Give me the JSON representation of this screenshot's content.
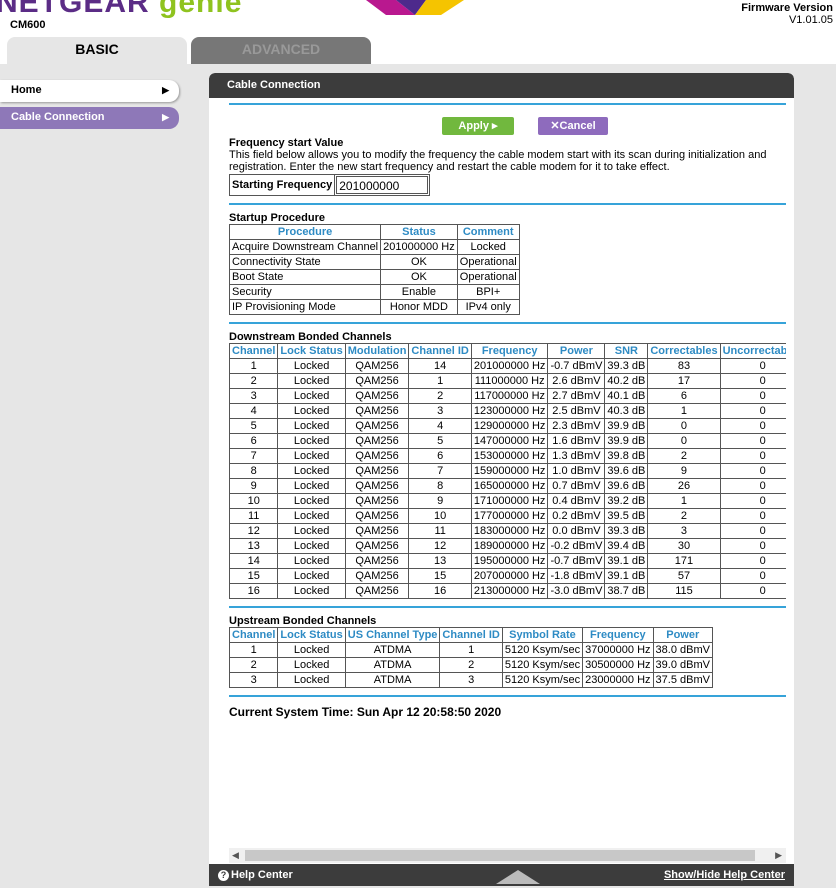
{
  "header": {
    "brand_main": "NETGEAR",
    "brand_genie": "genie",
    "model": "CM600",
    "firmware_label": "Firmware Version",
    "firmware_value": "V1.01.05"
  },
  "tabs": [
    {
      "label": "BASIC"
    },
    {
      "label": "ADVANCED"
    }
  ],
  "sidebar": {
    "items": [
      {
        "label": "Home"
      },
      {
        "label": "Cable Connection"
      }
    ]
  },
  "panel": {
    "title": "Cable Connection",
    "apply_label": "Apply ▸",
    "cancel_label": "✕Cancel",
    "freq": {
      "title": "Frequency start Value",
      "desc": "This field below allows you to modify the frequency the cable modem start with its scan during initialization and registration. Enter the new start frequency and restart the cable modem for it to take effect.",
      "label": "Starting Frequency",
      "value": "201000000"
    },
    "startup": {
      "title": "Startup Procedure",
      "headers": [
        "Procedure",
        "Status",
        "Comment"
      ],
      "rows": [
        [
          "Acquire Downstream Channel",
          "201000000 Hz",
          "Locked"
        ],
        [
          "Connectivity State",
          "OK",
          "Operational"
        ],
        [
          "Boot State",
          "OK",
          "Operational"
        ],
        [
          "Security",
          "Enable",
          "BPI+"
        ],
        [
          "IP Provisioning Mode",
          "Honor MDD",
          "IPv4 only"
        ]
      ]
    },
    "downstream": {
      "title": "Downstream Bonded Channels",
      "headers": [
        "Channel",
        "Lock Status",
        "Modulation",
        "Channel ID",
        "Frequency",
        "Power",
        "SNR",
        "Correctables",
        "Uncorrectables"
      ],
      "rows": [
        [
          "1",
          "Locked",
          "QAM256",
          "14",
          "201000000 Hz",
          "-0.7 dBmV",
          "39.3 dB",
          "83",
          "0"
        ],
        [
          "2",
          "Locked",
          "QAM256",
          "1",
          "111000000 Hz",
          "2.6 dBmV",
          "40.2 dB",
          "17",
          "0"
        ],
        [
          "3",
          "Locked",
          "QAM256",
          "2",
          "117000000 Hz",
          "2.7 dBmV",
          "40.1 dB",
          "6",
          "0"
        ],
        [
          "4",
          "Locked",
          "QAM256",
          "3",
          "123000000 Hz",
          "2.5 dBmV",
          "40.3 dB",
          "1",
          "0"
        ],
        [
          "5",
          "Locked",
          "QAM256",
          "4",
          "129000000 Hz",
          "2.3 dBmV",
          "39.9 dB",
          "0",
          "0"
        ],
        [
          "6",
          "Locked",
          "QAM256",
          "5",
          "147000000 Hz",
          "1.6 dBmV",
          "39.9 dB",
          "0",
          "0"
        ],
        [
          "7",
          "Locked",
          "QAM256",
          "6",
          "153000000 Hz",
          "1.3 dBmV",
          "39.8 dB",
          "2",
          "0"
        ],
        [
          "8",
          "Locked",
          "QAM256",
          "7",
          "159000000 Hz",
          "1.0 dBmV",
          "39.6 dB",
          "9",
          "0"
        ],
        [
          "9",
          "Locked",
          "QAM256",
          "8",
          "165000000 Hz",
          "0.7 dBmV",
          "39.6 dB",
          "26",
          "0"
        ],
        [
          "10",
          "Locked",
          "QAM256",
          "9",
          "171000000 Hz",
          "0.4 dBmV",
          "39.2 dB",
          "1",
          "0"
        ],
        [
          "11",
          "Locked",
          "QAM256",
          "10",
          "177000000 Hz",
          "0.2 dBmV",
          "39.5 dB",
          "2",
          "0"
        ],
        [
          "12",
          "Locked",
          "QAM256",
          "11",
          "183000000 Hz",
          "0.0 dBmV",
          "39.3 dB",
          "3",
          "0"
        ],
        [
          "13",
          "Locked",
          "QAM256",
          "12",
          "189000000 Hz",
          "-0.2 dBmV",
          "39.4 dB",
          "30",
          "0"
        ],
        [
          "14",
          "Locked",
          "QAM256",
          "13",
          "195000000 Hz",
          "-0.7 dBmV",
          "39.1 dB",
          "171",
          "0"
        ],
        [
          "15",
          "Locked",
          "QAM256",
          "15",
          "207000000 Hz",
          "-1.8 dBmV",
          "39.1 dB",
          "57",
          "0"
        ],
        [
          "16",
          "Locked",
          "QAM256",
          "16",
          "213000000 Hz",
          "-3.0 dBmV",
          "38.7 dB",
          "115",
          "0"
        ]
      ]
    },
    "upstream": {
      "title": "Upstream Bonded Channels",
      "headers": [
        "Channel",
        "Lock Status",
        "US Channel Type",
        "Channel ID",
        "Symbol Rate",
        "Frequency",
        "Power"
      ],
      "rows": [
        [
          "1",
          "Locked",
          "ATDMA",
          "1",
          "5120 Ksym/sec",
          "37000000 Hz",
          "38.0 dBmV"
        ],
        [
          "2",
          "Locked",
          "ATDMA",
          "2",
          "5120 Ksym/sec",
          "30500000 Hz",
          "39.0 dBmV"
        ],
        [
          "3",
          "Locked",
          "ATDMA",
          "3",
          "5120 Ksym/sec",
          "23000000 Hz",
          "37.5 dBmV"
        ]
      ]
    },
    "current_time": "Current System Time: Sun Apr 12 20:58:50 2020"
  },
  "footer": {
    "help_center": "Help Center",
    "show_hide": "Show/Hide Help Center"
  },
  "colors": {
    "brand_purple": "#5b2c86",
    "brand_green": "#8fc31f",
    "accent_blue": "#36a3d9",
    "apply_green": "#71b83e",
    "cancel_purple": "#8e6bbd"
  }
}
